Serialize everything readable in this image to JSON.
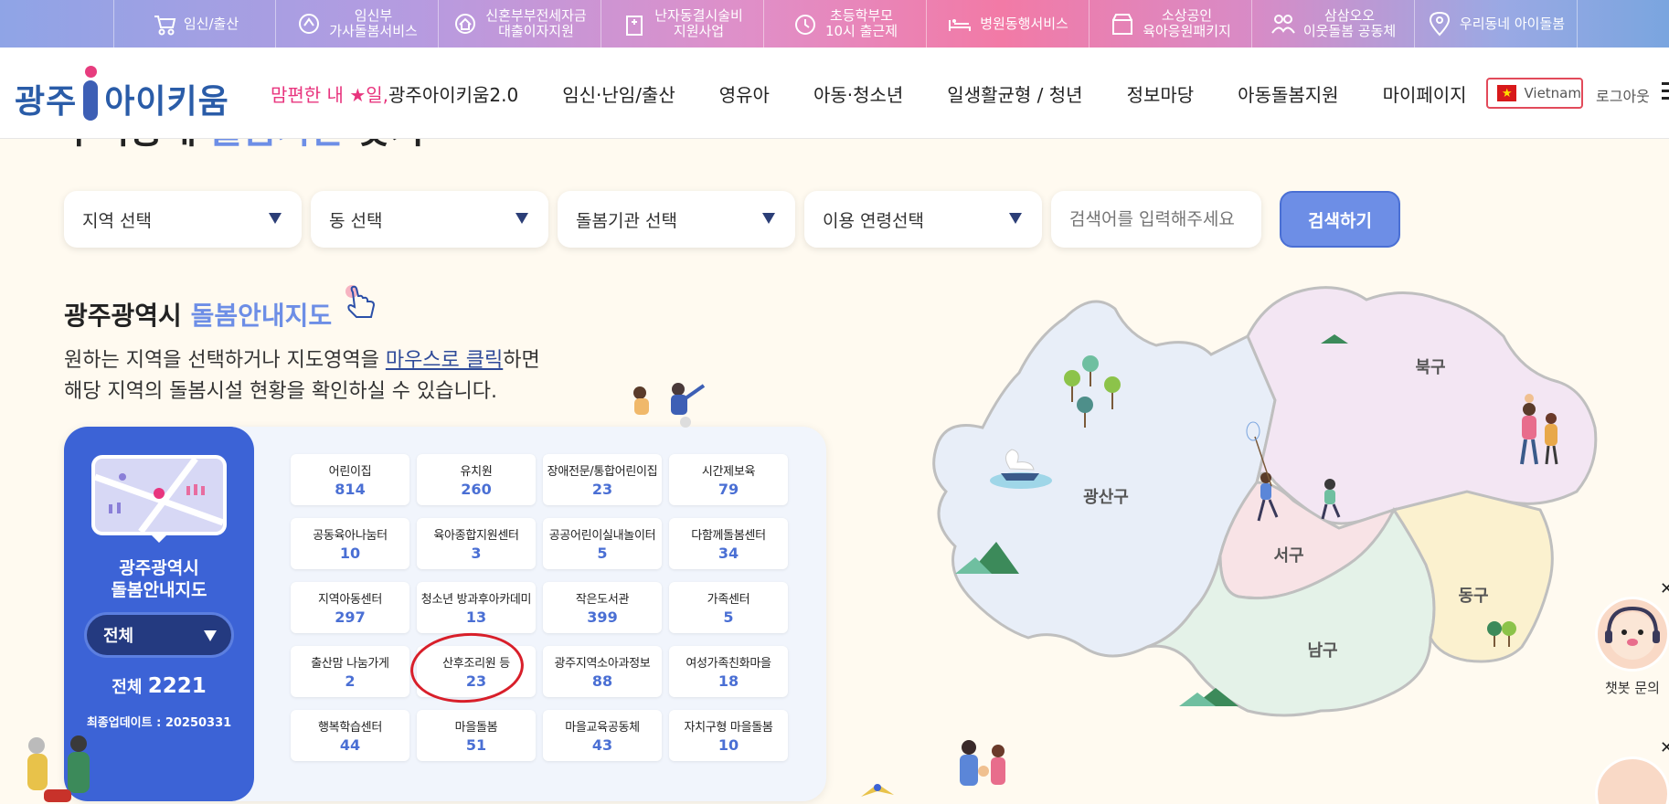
{
  "topbar": {
    "items": [
      {
        "label": "임신/출산",
        "icon": "stroller-icon"
      },
      {
        "label": "임신부\n가사돌봄서비스",
        "icon": "cleaning-hand-icon"
      },
      {
        "label": "신혼부부전세자금\n대출이자지원",
        "icon": "house-loan-icon"
      },
      {
        "label": "난자동결시술비\n지원사업",
        "icon": "hospital-icon"
      },
      {
        "label": "초등학부모\n10시 출근제",
        "icon": "alarm-clock-icon"
      },
      {
        "label": "병원동행서비스",
        "icon": "hospital-bed-icon"
      },
      {
        "label": "소상공인\n육아응원패키지",
        "icon": "shop-icon"
      },
      {
        "label": "삼삼오오\n이웃돌봄 공동체",
        "icon": "people-group-icon"
      },
      {
        "label": "우리동네 아이돌봄",
        "icon": "map-pin-icon"
      }
    ]
  },
  "header": {
    "logo_left": "광주",
    "logo_right": "아이키움",
    "nav": [
      {
        "pink": "맘편한 내 ★일,",
        "rest": "광주아이키움2.0"
      },
      {
        "pink": "",
        "rest": "임신·난임/출산"
      },
      {
        "pink": "",
        "rest": "영유아"
      },
      {
        "pink": "",
        "rest": "아동·청소년"
      },
      {
        "pink": "",
        "rest": "일생활균형 / 청년"
      },
      {
        "pink": "",
        "rest": "정보마당"
      },
      {
        "pink": "",
        "rest": "아동돌봄지원"
      },
      {
        "pink": "",
        "rest": "마이페이지"
      }
    ],
    "language": "Vietnam",
    "flag_star": "★",
    "logout": "로그아웃"
  },
  "cut_heading": {
    "prefix": "우리동네 ",
    "blue": "돌봄기관",
    "suffix": " 찾기"
  },
  "search": {
    "region": "지역 선택",
    "dong": "동 선택",
    "facility": "돌봄기관 선택",
    "age": "이용 연령선택",
    "placeholder": "검색어를 입력해주세요",
    "button": "검색하기"
  },
  "section": {
    "title_black": "광주광역시 ",
    "title_blue": "돌봄안내지도",
    "desc_1": "원하는 지역을 선택하거나 지도영역을 ",
    "desc_link": "마우스로 클릭",
    "desc_2": "하면",
    "desc_3": "해당 지역의 돌봄시설 현황을 확인하실 수 있습니다."
  },
  "panel": {
    "side_title": "광주광역시\n돌봄안내지도",
    "region_value": "전체",
    "total_label": "전체 ",
    "total_value": "2221",
    "updated": "최종업데이트 : 20250331",
    "categories": [
      {
        "name": "어린이집",
        "count": "814"
      },
      {
        "name": "유치원",
        "count": "260"
      },
      {
        "name": "장애전문/통합어린이집",
        "count": "23"
      },
      {
        "name": "시간제보육",
        "count": "79"
      },
      {
        "name": "공동육아나눔터",
        "count": "10"
      },
      {
        "name": "육아종합지원센터",
        "count": "3"
      },
      {
        "name": "공공어린이실내놀이터",
        "count": "5"
      },
      {
        "name": "다함께돌봄센터",
        "count": "34"
      },
      {
        "name": "지역아동센터",
        "count": "297"
      },
      {
        "name": "청소년 방과후아카데미",
        "count": "13"
      },
      {
        "name": "작은도서관",
        "count": "399"
      },
      {
        "name": "가족센터",
        "count": "5"
      },
      {
        "name": "출산맘 나눔가게",
        "count": "2"
      },
      {
        "name": "산후조리원 등",
        "count": "23"
      },
      {
        "name": "광주지역소아과정보",
        "count": "88"
      },
      {
        "name": "여성가족친화마을",
        "count": "18"
      },
      {
        "name": "행복학습센터",
        "count": "44"
      },
      {
        "name": "마을돌봄",
        "count": "51"
      },
      {
        "name": "마을교육공동체",
        "count": "43"
      },
      {
        "name": "자치구형 마을돌봄",
        "count": "10"
      }
    ]
  },
  "map": {
    "districts": [
      "광산구",
      "북구",
      "서구",
      "동구",
      "남구"
    ],
    "colors": {
      "gwangsan": "#e8eef8",
      "buk": "#f3e6f3",
      "seo": "#f8e3e6",
      "dong": "#fbf1cf",
      "nam": "#e4f2e8"
    }
  },
  "chatbot": {
    "label": "챗봇 문의"
  }
}
